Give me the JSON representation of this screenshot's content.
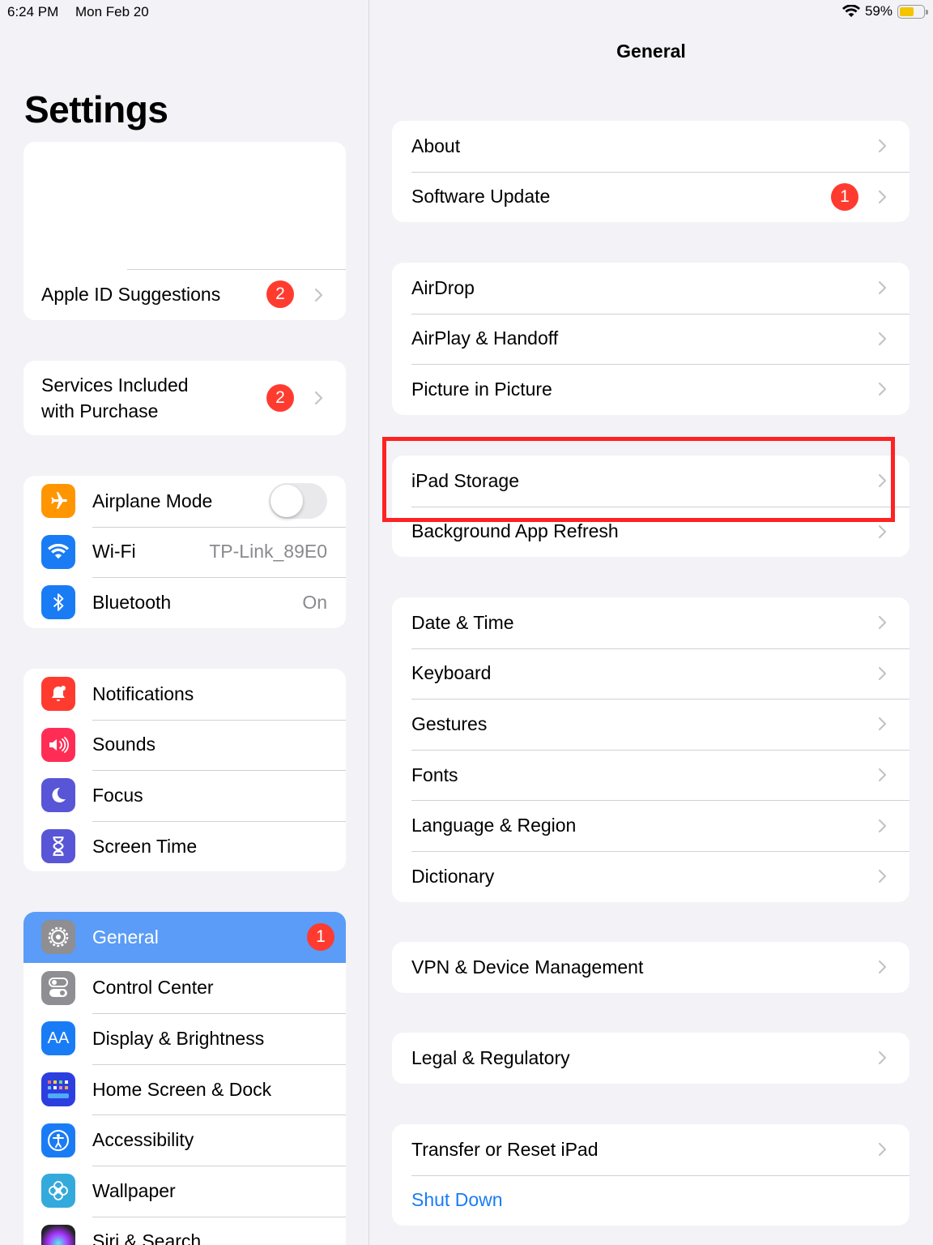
{
  "status": {
    "time": "6:24 PM",
    "date": "Mon Feb 20",
    "battery": "59%",
    "battery_fraction": 0.59
  },
  "sidebar": {
    "title": "Settings",
    "apple_id_suggestions": {
      "label": "Apple ID Suggestions",
      "badge": "2"
    },
    "services": {
      "label_line1": "Services Included",
      "label_line2": "with Purchase",
      "badge": "2"
    },
    "connectivity": [
      {
        "label": "Airplane Mode",
        "icon": "airplane-icon",
        "color": "#ff9500",
        "toggle": false
      },
      {
        "label": "Wi-Fi",
        "icon": "wifi-icon",
        "color": "#1a7cf5",
        "value": "TP-Link_89E0"
      },
      {
        "label": "Bluetooth",
        "icon": "bluetooth-icon",
        "color": "#1a7cf5",
        "value": "On"
      }
    ],
    "notifications": [
      {
        "label": "Notifications",
        "icon": "bell-icon",
        "color": "#ff3b30"
      },
      {
        "label": "Sounds",
        "icon": "speaker-icon",
        "color": "#ff2d55"
      },
      {
        "label": "Focus",
        "icon": "moon-icon",
        "color": "#5856d6"
      },
      {
        "label": "Screen Time",
        "icon": "hourglass-icon",
        "color": "#5856d6"
      }
    ],
    "general": [
      {
        "label": "General",
        "icon": "gear-icon",
        "color": "#8e8e93",
        "badge": "1",
        "selected": true
      },
      {
        "label": "Control Center",
        "icon": "toggles-icon",
        "color": "#8e8e93"
      },
      {
        "label": "Display & Brightness",
        "icon": "text-size-icon",
        "color": "#1a7cf5"
      },
      {
        "label": "Home Screen & Dock",
        "icon": "grid-icon",
        "color": "#2c3ee0"
      },
      {
        "label": "Accessibility",
        "icon": "accessibility-icon",
        "color": "#1a7cf5"
      },
      {
        "label": "Wallpaper",
        "icon": "flower-icon",
        "color": "#34aadc"
      },
      {
        "label": "Siri & Search",
        "icon": "siri-icon",
        "color": "#222222"
      }
    ]
  },
  "detail": {
    "title": "General",
    "groups": [
      [
        {
          "label": "About"
        },
        {
          "label": "Software Update",
          "badge": "1"
        }
      ],
      [
        {
          "label": "AirDrop"
        },
        {
          "label": "AirPlay & Handoff"
        },
        {
          "label": "Picture in Picture"
        }
      ],
      [
        {
          "label": "iPad Storage"
        },
        {
          "label": "Background App Refresh"
        }
      ],
      [
        {
          "label": "Date & Time"
        },
        {
          "label": "Keyboard"
        },
        {
          "label": "Gestures"
        },
        {
          "label": "Fonts"
        },
        {
          "label": "Language & Region"
        },
        {
          "label": "Dictionary"
        }
      ],
      [
        {
          "label": "VPN & Device Management"
        }
      ],
      [
        {
          "label": "Legal & Regulatory"
        }
      ],
      [
        {
          "label": "Transfer or Reset iPad"
        },
        {
          "label": "Shut Down",
          "link": true
        }
      ]
    ]
  },
  "colors": {
    "highlight": "#ff2222",
    "link": "#1a7cf5",
    "badge": "#ff3b30",
    "selected": "#5a9cf7"
  }
}
